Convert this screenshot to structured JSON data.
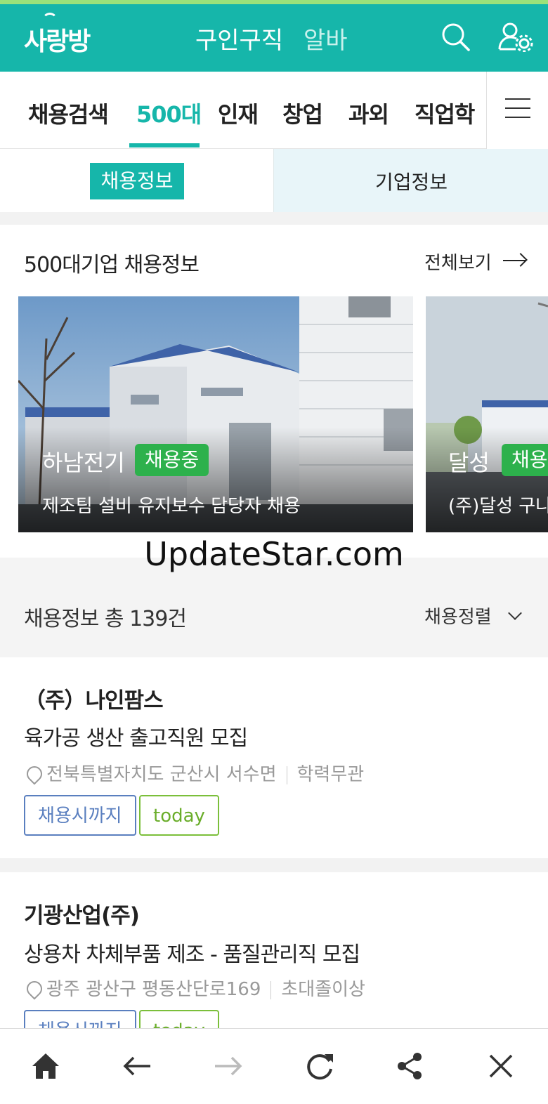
{
  "header": {
    "logo": "사랑방",
    "title": "구인구직",
    "title_secondary": "알바"
  },
  "nav": {
    "items": [
      {
        "label": "채용검색"
      },
      {
        "label": "500대"
      },
      {
        "label": "인재"
      },
      {
        "label": "창업"
      },
      {
        "label": "과외"
      },
      {
        "label": "직업학"
      }
    ],
    "active_index": 1
  },
  "subtabs": {
    "active": "채용정보",
    "other": "기업정보"
  },
  "featured": {
    "title": "500대기업 채용정보",
    "view_all": "전체보기",
    "cards": [
      {
        "company": "하남전기",
        "badge": "채용중",
        "desc": "제조팀 설비 유지보수 담당자 채용"
      },
      {
        "company": "달성",
        "badge": "채용",
        "desc": "(주)달성 구나"
      }
    ]
  },
  "watermark": "UpdateStar.com",
  "listing_header": {
    "count_text": "채용정보 총 139건",
    "sort_label": "채용정렬"
  },
  "listings": [
    {
      "company": "（주）나인팜스",
      "title": "육가공 생산 출고직원 모집",
      "location": "전북특별자치도 군산시 서수면",
      "education": "학력무관",
      "tags": [
        "채용시까지",
        "today"
      ]
    },
    {
      "company": "기광산업(주)",
      "title": "상용차 차체부품 제조 - 품질관리직 모집",
      "location": "광주 광산구 평동산단로169",
      "education": "초대졸이상",
      "tags": [
        "채용시까지",
        "today"
      ]
    }
  ],
  "colors": {
    "brand": "#16b6aa",
    "badge_green": "#2db14c",
    "tag_blue": "#5a7fbf",
    "tag_green": "#7bbf3a"
  },
  "icons": {
    "header": [
      "search-icon",
      "user-settings-icon"
    ],
    "bottom": [
      "home-icon",
      "back-arrow-icon",
      "forward-arrow-icon",
      "refresh-icon",
      "share-icon",
      "close-icon"
    ]
  }
}
